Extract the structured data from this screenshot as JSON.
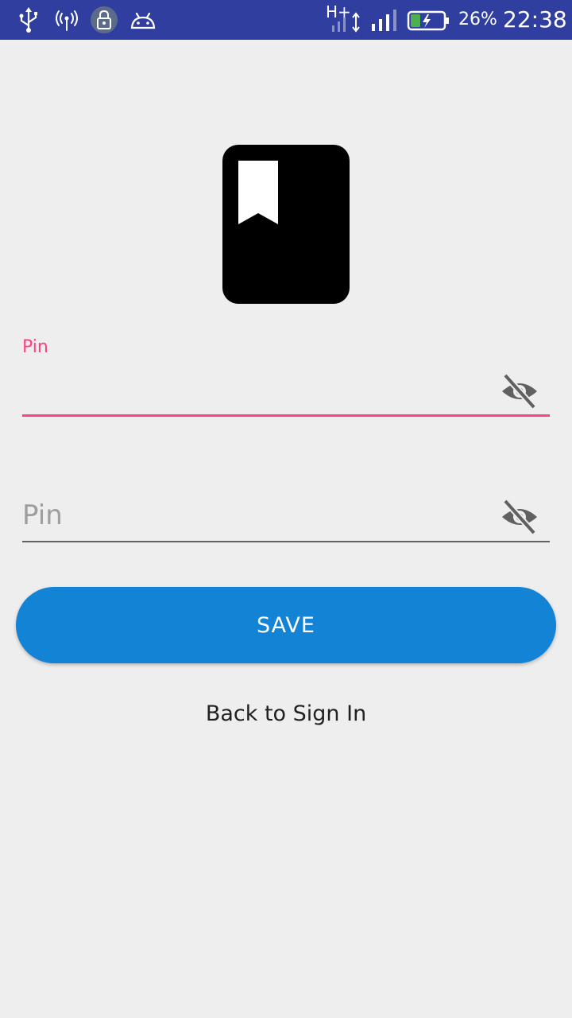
{
  "status_bar": {
    "network_type": "H+",
    "battery_percent": "26%",
    "time": "22:38",
    "background_color": "#303f9f",
    "icons": [
      "usb-icon",
      "hotspot-icon",
      "vpn-lock-icon",
      "android-debug-icon",
      "network-activity-icon",
      "signal-strength-icon",
      "battery-charging-icon"
    ]
  },
  "logo": {
    "icon": "bookmark-book-icon"
  },
  "form": {
    "pin_field": {
      "label": "Pin",
      "value": "",
      "toggle_icon": "visibility-off-icon",
      "focused": true
    },
    "confirm_pin_field": {
      "placeholder": "Pin",
      "value": "",
      "toggle_icon": "visibility-off-icon",
      "focused": false
    },
    "save_label": "SAVE",
    "back_label": "Back to Sign In"
  },
  "colors": {
    "accent": "#ff4081",
    "primary_button": "#1383d6",
    "background": "#eeeeee"
  }
}
